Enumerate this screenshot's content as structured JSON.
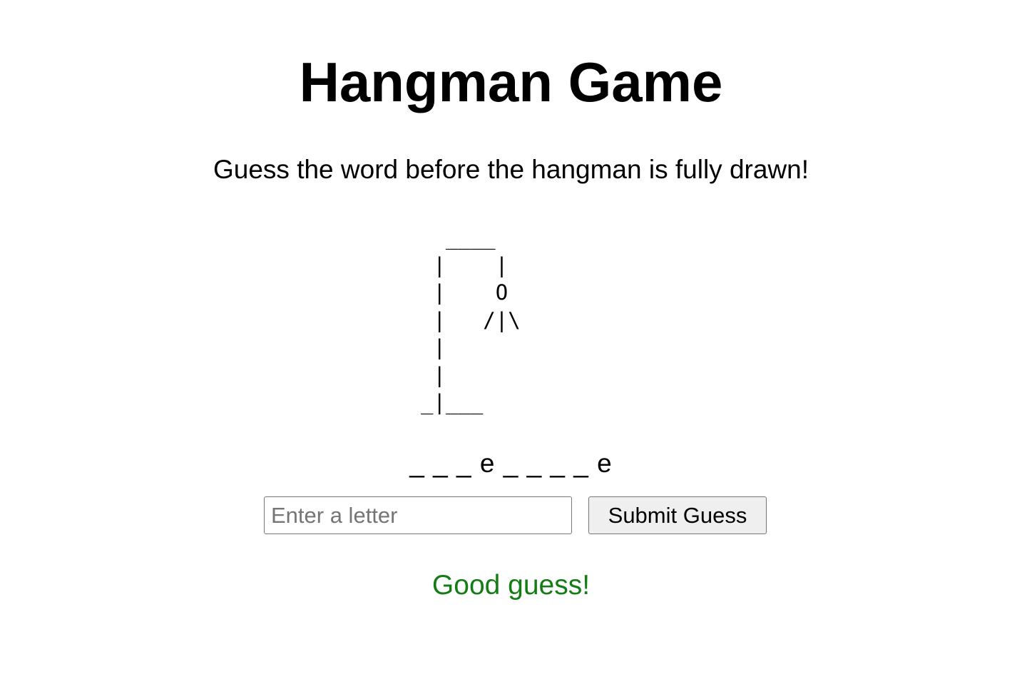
{
  "title": "Hangman Game",
  "subtitle": "Guess the word before the hangman is fully drawn!",
  "hangman": {
    "drawing": "  ____\n |    |\n |    O\n |   /|\\\n |\n |\n_|___"
  },
  "word": {
    "display": "_ _ _ e _ _ _ _ e"
  },
  "guess_form": {
    "value": "",
    "placeholder": "Enter a letter",
    "submit_label": "Submit Guess"
  },
  "message": {
    "text": "Good guess!",
    "color": "#137d13"
  }
}
